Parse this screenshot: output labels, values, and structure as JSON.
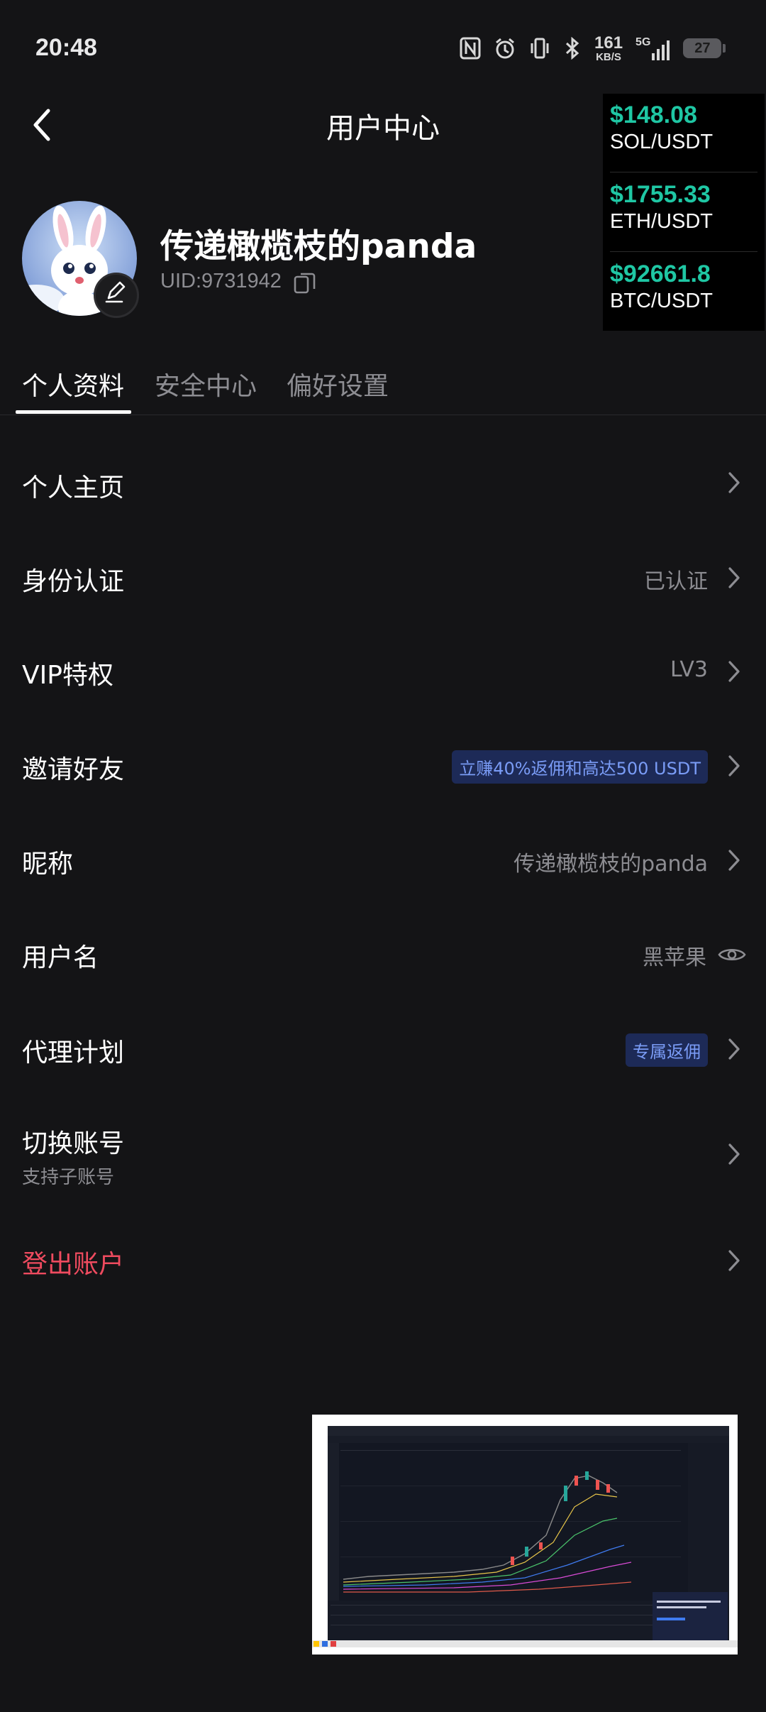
{
  "status_bar": {
    "time": "20:48",
    "icons": [
      "nfc-icon",
      "alarm-icon",
      "vibrate-icon",
      "bluetooth-icon"
    ],
    "net_speed_value": "161",
    "net_speed_unit": "KB/S",
    "network": "5G",
    "battery": "27"
  },
  "header": {
    "title": "用户中心",
    "back_icon": "chevron-left-icon"
  },
  "ticker": [
    {
      "price": "$148.08",
      "pair": "SOL/USDT"
    },
    {
      "price": "$1755.33",
      "pair": "ETH/USDT"
    },
    {
      "price": "$92661.8",
      "pair": "BTC/USDT"
    }
  ],
  "profile": {
    "name": "传递橄榄枝的panda",
    "uid": "UID:9731942"
  },
  "tabs": [
    {
      "label": "个人资料",
      "active": true
    },
    {
      "label": "安全中心",
      "active": false
    },
    {
      "label": "偏好设置",
      "active": false
    }
  ],
  "rows": {
    "homepage": {
      "label": "个人主页"
    },
    "identity": {
      "label": "身份认证",
      "value": "已认证"
    },
    "vip": {
      "label": "VIP特权",
      "value": "LV3"
    },
    "invite": {
      "label": "邀请好友",
      "badge": "立赚40%返佣和高达500 USDT"
    },
    "nickname": {
      "label": "昵称",
      "value": "传递橄榄枝的panda"
    },
    "username": {
      "label": "用户名",
      "value": "黑苹果"
    },
    "agent": {
      "label": "代理计划",
      "badge": "专属返佣"
    },
    "switch": {
      "label": "切换账号",
      "sub": "支持子账号"
    },
    "logout": {
      "label": "登出账户"
    }
  },
  "colors": {
    "background": "#141416",
    "ticker_price": "#1fc7a4",
    "logout": "#ef4b5f",
    "badge_bg": "#1d2a57",
    "badge_text": "#7a9cf6"
  }
}
